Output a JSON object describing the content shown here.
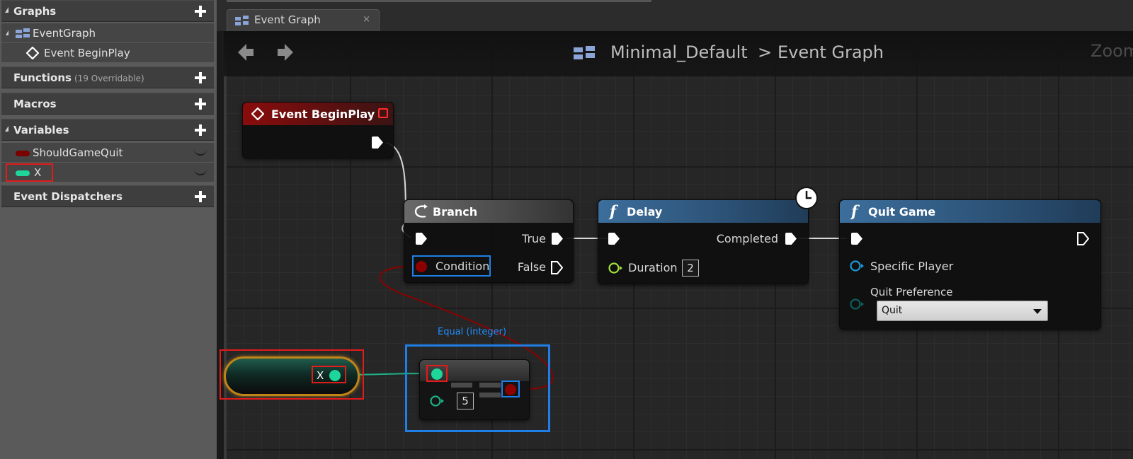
{
  "left_panel": {
    "graphs": {
      "label": "Graphs",
      "items": [
        "EventGraph",
        "Event BeginPlay"
      ]
    },
    "functions": {
      "label": "Functions",
      "sub": "(19 Overridable)"
    },
    "macros": {
      "label": "Macros"
    },
    "variables": {
      "label": "Variables",
      "items": [
        {
          "name": "ShouldGameQuit",
          "color": "#7a0000"
        },
        {
          "name": "X",
          "color": "#1fd69a"
        }
      ]
    },
    "dispatchers": {
      "label": "Event Dispatchers"
    }
  },
  "tab": {
    "label": "Event Graph",
    "close": "×"
  },
  "breadcrumb": {
    "blueprint": "Minimal_Default",
    "separator": ">",
    "graph": "Event Graph"
  },
  "zoom_label": "Zoom",
  "nodes": {
    "begin_play": {
      "title": "Event BeginPlay",
      "color": "#8a0c0c"
    },
    "branch": {
      "title": "Branch",
      "true_label": "True",
      "false_label": "False",
      "condition_label": "Condition"
    },
    "delay": {
      "title": "Delay",
      "completed_label": "Completed",
      "duration_label": "Duration",
      "duration_value": "2"
    },
    "quit_game": {
      "title": "Quit Game",
      "specific_player_label": "Specific Player",
      "quit_pref_label": "Quit Preference",
      "quit_pref_value": "Quit"
    },
    "get_x": {
      "label": "X"
    },
    "equal": {
      "caption": "Equal (integer)",
      "b_value": "5"
    }
  },
  "colors": {
    "exec": "#ffffff",
    "bool": "#8c0000",
    "int": "#1fd69a",
    "float": "#a0e03c",
    "object": "#1a9ad6",
    "byte": "#0c5f5a",
    "annotation_red": "#e21b1b",
    "annotation_blue": "#1f7fe6"
  }
}
